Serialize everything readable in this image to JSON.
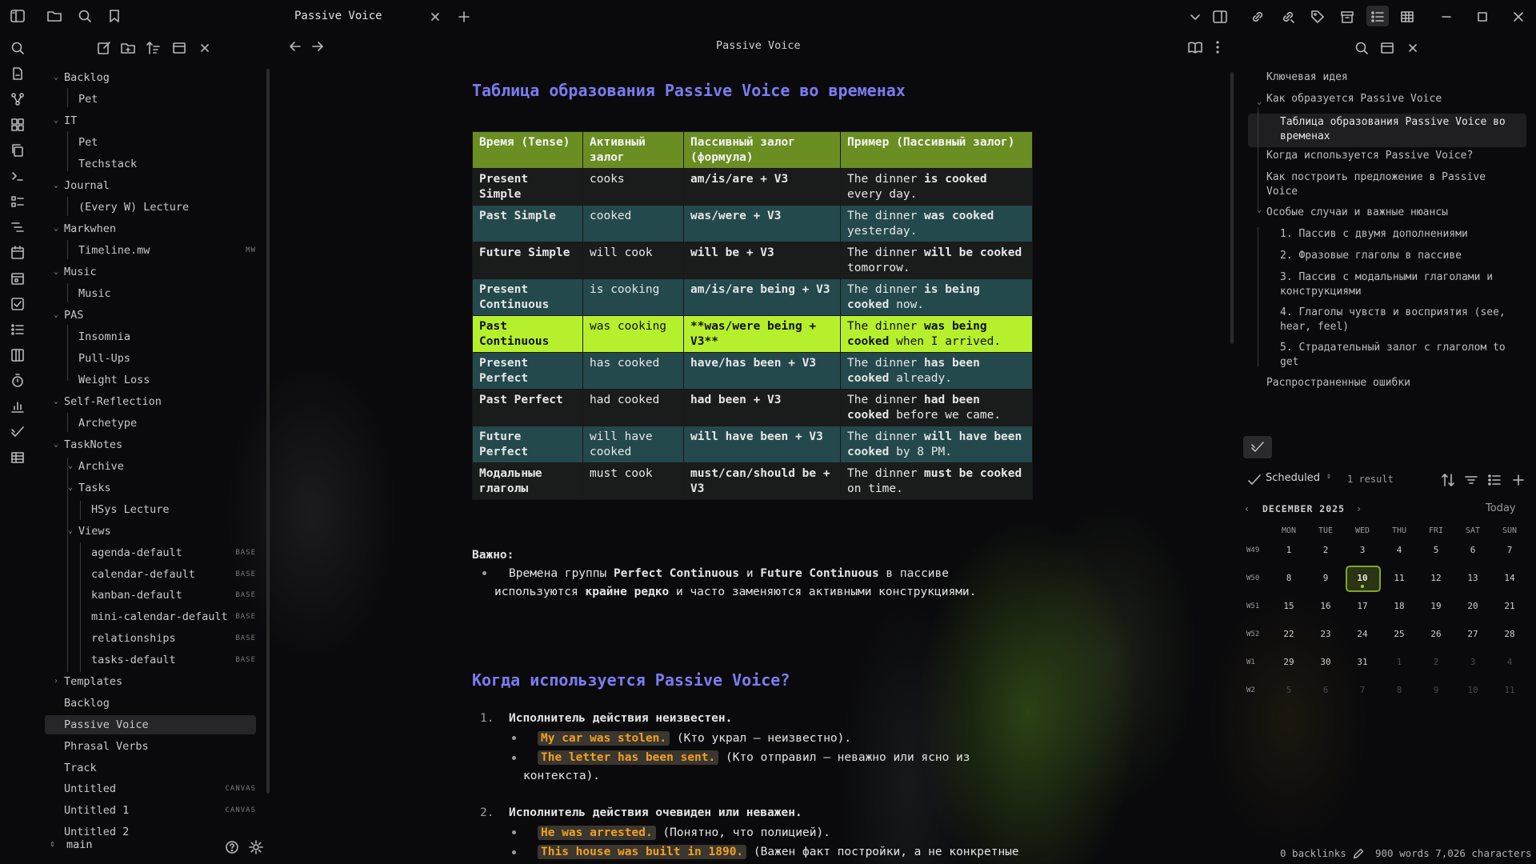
{
  "tab": {
    "title": "Passive Voice"
  },
  "view_header": {
    "title": "Passive Voice"
  },
  "sidebar": {
    "tree": [
      {
        "label": "Backlog",
        "tag": ""
      },
      {
        "label": "Pet",
        "tag": ""
      },
      {
        "label": "IT",
        "tag": ""
      },
      {
        "label": "Pet",
        "tag": ""
      },
      {
        "label": "Techstack",
        "tag": ""
      },
      {
        "label": "Journal",
        "tag": ""
      },
      {
        "label": "(Every W) Lecture",
        "tag": ""
      },
      {
        "label": "Markwhen",
        "tag": ""
      },
      {
        "label": "Timeline.mw",
        "tag": "MW"
      },
      {
        "label": "Music",
        "tag": ""
      },
      {
        "label": "Music",
        "tag": ""
      },
      {
        "label": "PAS",
        "tag": ""
      },
      {
        "label": "Insomnia",
        "tag": ""
      },
      {
        "label": "Pull-Ups",
        "tag": ""
      },
      {
        "label": "Weight Loss",
        "tag": ""
      },
      {
        "label": "Self-Reflection",
        "tag": ""
      },
      {
        "label": "Archetype",
        "tag": ""
      },
      {
        "label": "TaskNotes",
        "tag": ""
      },
      {
        "label": "Archive",
        "tag": ""
      },
      {
        "label": "Tasks",
        "tag": ""
      },
      {
        "label": "HSys Lecture",
        "tag": ""
      },
      {
        "label": "Views",
        "tag": ""
      },
      {
        "label": "agenda-default",
        "tag": "BASE"
      },
      {
        "label": "calendar-default",
        "tag": "BASE"
      },
      {
        "label": "kanban-default",
        "tag": "BASE"
      },
      {
        "label": "mini-calendar-default",
        "tag": "BASE"
      },
      {
        "label": "relationships",
        "tag": "BASE"
      },
      {
        "label": "tasks-default",
        "tag": "BASE"
      },
      {
        "label": "Templates",
        "tag": ""
      },
      {
        "label": "Backlog",
        "tag": ""
      },
      {
        "label": "Passive Voice",
        "tag": ""
      },
      {
        "label": "Phrasal Verbs",
        "tag": ""
      },
      {
        "label": "Track",
        "tag": ""
      },
      {
        "label": "Untitled",
        "tag": "CANVAS"
      },
      {
        "label": "Untitled 1",
        "tag": "CANVAS"
      },
      {
        "label": "Untitled 2",
        "tag": ""
      }
    ],
    "vault": "main"
  },
  "doc": {
    "h_table": "Таблица образования Passive Voice во временах",
    "table_headers": [
      "Время (Tense)",
      "Активный залог",
      "Пассивный залог (формула)",
      "Пример (Пассивный залог)"
    ],
    "table_rows": [
      {
        "tense": "Present Simple",
        "active": "cooks",
        "formula": "am/is/are + V3",
        "ex_a": "The dinner ",
        "ex_b": "is cooked",
        "ex_c": " every day."
      },
      {
        "tense": "Past Simple",
        "active": "cooked",
        "formula": "was/were + V3",
        "ex_a": "The dinner ",
        "ex_b": "was cooked",
        "ex_c": " yesterday."
      },
      {
        "tense": "Future Simple",
        "active": "will cook",
        "formula": "will be + V3",
        "ex_a": "The dinner ",
        "ex_b": "will be cooked",
        "ex_c": " tomorrow."
      },
      {
        "tense": "Present Continuous",
        "active": "is cooking",
        "formula": "am/is/are being + V3",
        "ex_a": "The dinner ",
        "ex_b": "is being cooked",
        "ex_c": " now."
      },
      {
        "tense": "Past Continuous",
        "active": "was cooking",
        "formula": "**was/were being + V3**",
        "ex_a": "The dinner ",
        "ex_b": "was being cooked",
        "ex_c": " when I arrived."
      },
      {
        "tense": "Present Perfect",
        "active": "has cooked",
        "formula": "have/has been + V3",
        "ex_a": "The dinner ",
        "ex_b": "has been cooked",
        "ex_c": " already."
      },
      {
        "tense": "Past Perfect",
        "active": "had cooked",
        "formula": "had been + V3",
        "ex_a": "The dinner ",
        "ex_b": "had been cooked",
        "ex_c": " before we came."
      },
      {
        "tense": "Future Perfect",
        "active": "will have cooked",
        "formula": "will have been + V3",
        "ex_a": "The dinner ",
        "ex_b": "will have been cooked",
        "ex_c": " by 8 PM."
      },
      {
        "tense": "Модальные глаголы",
        "active": "must cook",
        "formula": "must/can/should be + V3",
        "ex_a": "The dinner ",
        "ex_b": "must be cooked",
        "ex_c": " on time."
      }
    ],
    "important_label": "Важно:",
    "important_1": "Времена группы ",
    "important_b1": "Perfect Continuous",
    "important_2": " и ",
    "important_b2": "Future Continuous",
    "important_3": " в пассиве",
    "important_4": "используются ",
    "important_b3": "крайне редко",
    "important_5": " и часто заменяются активными конструкциями.",
    "h_when": "Когда используется Passive Voice?",
    "item1_num": "1.",
    "item1_title": "Исполнитель действия неизвестен.",
    "item1_ex1_code": "My car was stolen.",
    "item1_ex1_text": " (Кто украл — неизвестно).",
    "item1_ex2_code": "The letter has been sent.",
    "item1_ex2_text": " (Кто отправил — неважно или ясно из",
    "item1_ex2_text2": "контекста).",
    "item2_num": "2.",
    "item2_title": "Исполнитель действия очевиден или неважен.",
    "item2_ex1_code": "He was arrested.",
    "item2_ex1_text": " (Понятно, что полицией).",
    "item2_ex2_code": "This house was built in 1890.",
    "item2_ex2_text": " (Важен факт постройки, а не конкретные"
  },
  "outline": [
    {
      "label": "Ключевая идея"
    },
    {
      "label": "Как образуется Passive Voice"
    },
    {
      "label": "Таблица образования Passive Voice во временах"
    },
    {
      "label": "Когда используется Passive Voice?"
    },
    {
      "label": "Как построить предложение в Passive Voice"
    },
    {
      "label": "Особые случаи и важные нюансы"
    },
    {
      "label": "1. Пассив с двумя дополнениями"
    },
    {
      "label": "2. Фразовые глаголы в пассиве"
    },
    {
      "label": "3. Пассив с модальными глаголами и конструкциями"
    },
    {
      "label": "4. Глаголы чувств и восприятия (see, hear, feel)"
    },
    {
      "label": "5. Страдательный залог с глаголом to get"
    },
    {
      "label": "Распространенные ошибки"
    }
  ],
  "tasks": {
    "view": "Scheduled",
    "results": "1 result",
    "month": "DECEMBER 2025",
    "today": "Today",
    "weekdays": [
      "MON",
      "TUE",
      "WED",
      "THU",
      "FRI",
      "SAT",
      "SUN"
    ],
    "weeks": [
      {
        "label": "W49",
        "days": [
          "1",
          "2",
          "3",
          "4",
          "5",
          "6",
          "7"
        ]
      },
      {
        "label": "W50",
        "days": [
          "8",
          "9",
          "10",
          "11",
          "12",
          "13",
          "14"
        ]
      },
      {
        "label": "W51",
        "days": [
          "15",
          "16",
          "17",
          "18",
          "19",
          "20",
          "21"
        ]
      },
      {
        "label": "W52",
        "days": [
          "22",
          "23",
          "24",
          "25",
          "26",
          "27",
          "28"
        ]
      },
      {
        "label": "W1",
        "days": [
          "29",
          "30",
          "31",
          "1",
          "2",
          "3",
          "4"
        ]
      },
      {
        "label": "W2",
        "days": [
          "5",
          "6",
          "7",
          "8",
          "9",
          "10",
          "11"
        ]
      }
    ],
    "selected_day": "10"
  },
  "status": {
    "backlinks": "0 backlinks",
    "counts": "900 words 7,026 characters"
  }
}
